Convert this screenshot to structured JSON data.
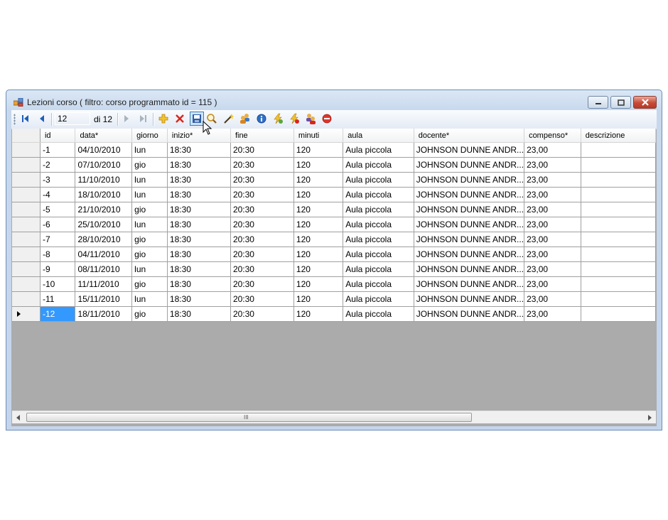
{
  "window": {
    "title": "Lezioni corso ( filtro: corso programmato id = 115 )"
  },
  "navigator": {
    "position": "12",
    "of_label": "di 12",
    "icons": [
      "first-icon",
      "prev-icon",
      "next-icon",
      "last-icon",
      "add-icon",
      "delete-icon",
      "save-icon",
      "search-icon",
      "wand-icon",
      "users-icon",
      "info-icon",
      "lightning-icon",
      "lightning-alt-icon",
      "user-group-icon",
      "stop-icon"
    ]
  },
  "grid": {
    "columns": [
      "id",
      "data*",
      "giorno",
      "inizio*",
      "fine",
      "minuti",
      "aula",
      "docente*",
      "compenso*",
      "descrizione"
    ],
    "rows": [
      [
        "-1",
        "04/10/2010",
        "lun",
        "18:30",
        "20:30",
        "120",
        "Aula piccola",
        "JOHNSON DUNNE ANDR...",
        "23,00",
        ""
      ],
      [
        "-2",
        "07/10/2010",
        "gio",
        "18:30",
        "20:30",
        "120",
        "Aula piccola",
        "JOHNSON DUNNE ANDR...",
        "23,00",
        ""
      ],
      [
        "-3",
        "11/10/2010",
        "lun",
        "18:30",
        "20:30",
        "120",
        "Aula piccola",
        "JOHNSON DUNNE ANDR...",
        "23,00",
        ""
      ],
      [
        "-4",
        "18/10/2010",
        "lun",
        "18:30",
        "20:30",
        "120",
        "Aula piccola",
        "JOHNSON DUNNE ANDR...",
        "23,00",
        ""
      ],
      [
        "-5",
        "21/10/2010",
        "gio",
        "18:30",
        "20:30",
        "120",
        "Aula piccola",
        "JOHNSON DUNNE ANDR...",
        "23,00",
        ""
      ],
      [
        "-6",
        "25/10/2010",
        "lun",
        "18:30",
        "20:30",
        "120",
        "Aula piccola",
        "JOHNSON DUNNE ANDR...",
        "23,00",
        ""
      ],
      [
        "-7",
        "28/10/2010",
        "gio",
        "18:30",
        "20:30",
        "120",
        "Aula piccola",
        "JOHNSON DUNNE ANDR...",
        "23,00",
        ""
      ],
      [
        "-8",
        "04/11/2010",
        "gio",
        "18:30",
        "20:30",
        "120",
        "Aula piccola",
        "JOHNSON DUNNE ANDR...",
        "23,00",
        ""
      ],
      [
        "-9",
        "08/11/2010",
        "lun",
        "18:30",
        "20:30",
        "120",
        "Aula piccola",
        "JOHNSON DUNNE ANDR...",
        "23,00",
        ""
      ],
      [
        "-10",
        "11/11/2010",
        "gio",
        "18:30",
        "20:30",
        "120",
        "Aula piccola",
        "JOHNSON DUNNE ANDR...",
        "23,00",
        ""
      ],
      [
        "-11",
        "15/11/2010",
        "lun",
        "18:30",
        "20:30",
        "120",
        "Aula piccola",
        "JOHNSON DUNNE ANDR...",
        "23,00",
        ""
      ],
      [
        "-12",
        "18/11/2010",
        "gio",
        "18:30",
        "20:30",
        "120",
        "Aula piccola",
        "JOHNSON DUNNE ANDR...",
        "23,00",
        ""
      ]
    ],
    "current_row": 11,
    "selection_color": "#3399ff"
  },
  "scrollbar": {
    "grip_label": "III"
  }
}
